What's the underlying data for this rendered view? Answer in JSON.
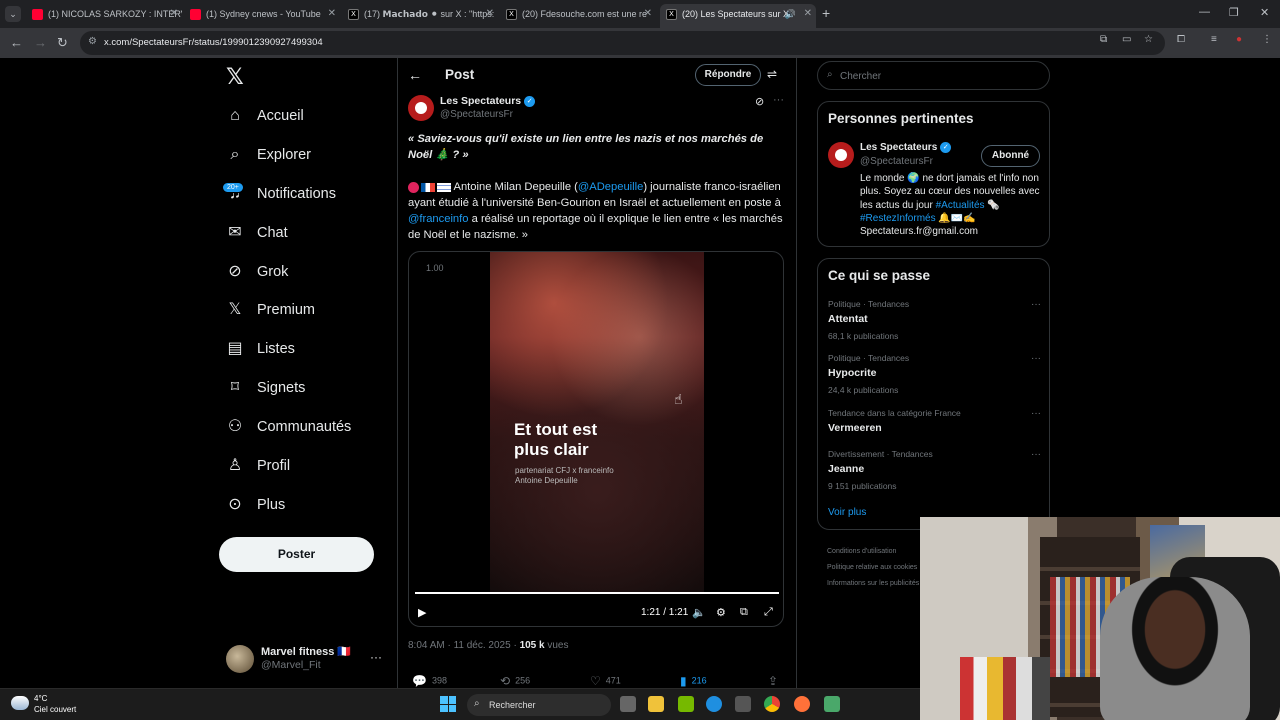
{
  "browser": {
    "tabs": [
      {
        "title": "(1) NICOLAS SARKOZY : INTERV",
        "icon": "youtube-icon"
      },
      {
        "title": "(1) Sydney cnews - YouTube",
        "icon": "youtube-icon"
      },
      {
        "title": "(17) 𝗠𝗮𝗰𝗵𝗮𝗱𝗼 ⚫ sur X : \"https:",
        "icon": "x-icon"
      },
      {
        "title": "(20) Fdesouche.com est une re",
        "icon": "x-icon"
      },
      {
        "title": "(20) Les Spectateurs sur X",
        "icon": "x-icon",
        "active": true
      }
    ],
    "url": "x.com/SpectateursFr/status/1999012390927499304"
  },
  "nav": {
    "items": [
      {
        "label": "Accueil",
        "icon": "home-icon",
        "glyph": "⌂"
      },
      {
        "label": "Explorer",
        "icon": "search-icon",
        "glyph": "⌕"
      },
      {
        "label": "Notifications",
        "icon": "bell-icon",
        "glyph": "♫"
      },
      {
        "label": "Chat",
        "icon": "mail-icon",
        "glyph": "✉"
      },
      {
        "label": "Grok",
        "icon": "grok-icon",
        "glyph": "⊘"
      },
      {
        "label": "Premium",
        "icon": "x-premium-icon",
        "glyph": "𝕏"
      },
      {
        "label": "Listes",
        "icon": "list-icon",
        "glyph": "▤"
      },
      {
        "label": "Signets",
        "icon": "bookmark-icon",
        "glyph": "⌑"
      },
      {
        "label": "Communautés",
        "icon": "communities-icon",
        "glyph": "⚇"
      },
      {
        "label": "Profil",
        "icon": "profile-icon",
        "glyph": "♙"
      },
      {
        "label": "Plus",
        "icon": "more-circle-icon",
        "glyph": "⊙"
      }
    ],
    "notif_badge": "20+",
    "post_button": "Poster",
    "account": {
      "name": "Marvel fitness 🇫🇷",
      "handle": "@Marvel_Fit"
    }
  },
  "post": {
    "header_title": "Post",
    "reply_button": "Répondre",
    "author": {
      "name": "Les Spectateurs",
      "handle": "@SpectateursFr"
    },
    "quote": "« Saviez-vous qu'il existe un lien entre les nazis et nos marchés de Noël 🎄 ? »",
    "body_part1": "Antoine Milan Depeuille (",
    "mention1": "@ADepeuille",
    "body_part2": ") journaliste franco-israélien ayant étudié à l'université Ben-Gourion en Israël et actuellement en poste à ",
    "mention2": "@franceinfo",
    "body_part3": " a réalisé un reportage où il explique le lien entre « les marchés de Noël et le nazisme. »",
    "video": {
      "speed": "1.00",
      "caption": "Et tout est plus clair",
      "sub1": "partenariat CFJ x franceinfo",
      "sub2": "Antoine Depeuille",
      "time": "1:21 / 1:21",
      "progress": 1.0
    },
    "meta_time": "8:04 AM · 11 déc. 2025 · ",
    "views_count": "105 k",
    "views_label": " vues",
    "stats": {
      "replies": "398",
      "reposts": "256",
      "likes": "471",
      "bookmarks": "216"
    }
  },
  "sidebar": {
    "search_placeholder": "Chercher",
    "relevant_title": "Personnes pertinentes",
    "relevant": {
      "name": "Les Spectateurs",
      "handle": "@SpectateursFr",
      "follow_label": "Abonné",
      "bio1": "Le monde 🌍 ne dort jamais et l'info non plus. Soyez au cœur des nouvelles avec les actus du jour ",
      "tag1": "#Actualités",
      "bio2": " 🗞️ ",
      "tag2": "#RestezInformés",
      "bio3": " 🔔✉️✍️ Spectateurs.fr@gmail.com"
    },
    "trends_title": "Ce qui se passe",
    "trends": [
      {
        "context": "Politique · Tendances",
        "name": "Attentat",
        "count": "68,1 k publications"
      },
      {
        "context": "Politique · Tendances",
        "name": "Hypocrite",
        "count": "24,4 k publications"
      },
      {
        "context": "Tendance dans la catégorie France",
        "name": "Vermeeren",
        "count": ""
      },
      {
        "context": "Divertissement · Tendances",
        "name": "Jeanne",
        "count": "9 151 publications"
      }
    ],
    "see_more": "Voir plus",
    "footer": [
      "Conditions d'utilisation",
      "Politique relative aux cookies",
      "Informations sur les publicités"
    ]
  },
  "taskbar": {
    "temp": "4°C",
    "weather": "Ciel couvert",
    "search_label": "Rechercher"
  }
}
